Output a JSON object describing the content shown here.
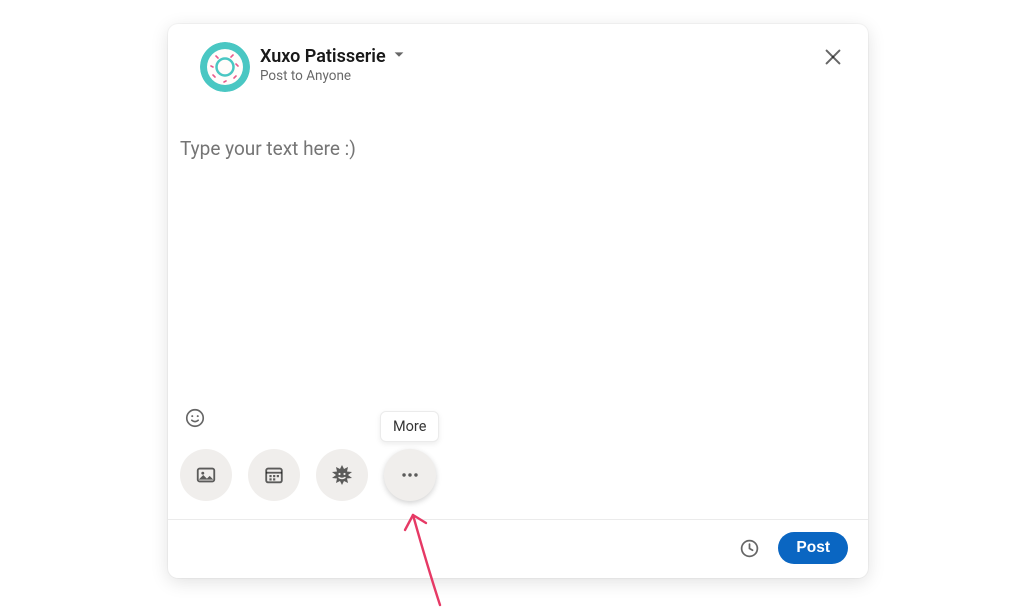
{
  "composer": {
    "user_name": "Xuxo Patisserie",
    "audience_label": "Post to Anyone",
    "placeholder": "Type your text here :)"
  },
  "toolbar": {
    "tooltip_more": "More"
  },
  "footer": {
    "post_label": "Post"
  },
  "avatar": {
    "ring_color": "#4ac7c3",
    "inner_color": "#fffdfb",
    "sprinkle_color": "#e85a8c"
  }
}
